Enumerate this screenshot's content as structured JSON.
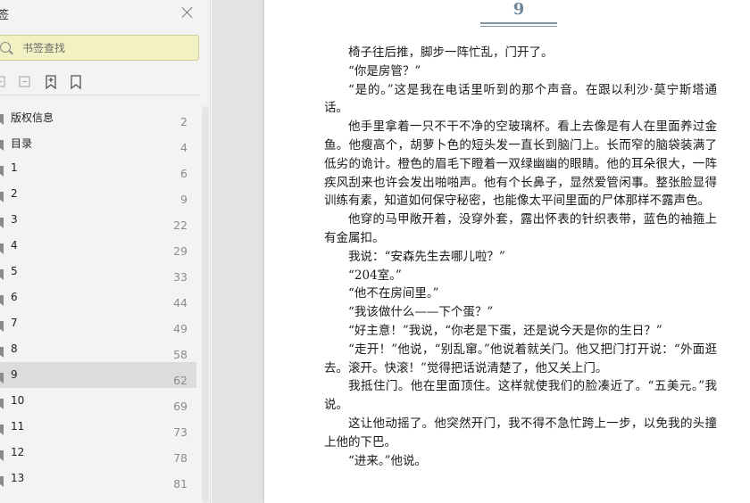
{
  "sidebar": {
    "title": "签",
    "search": {
      "placeholder": "书签查找"
    },
    "toolbar_icons": [
      "expand-all-icon",
      "collapse-all-icon",
      "add-bookmark-icon",
      "bookmark-icon"
    ],
    "items": [
      {
        "label": "版权信息",
        "page": "2"
      },
      {
        "label": "目录",
        "page": "4"
      },
      {
        "label": "1",
        "page": "6"
      },
      {
        "label": "2",
        "page": "9"
      },
      {
        "label": "3",
        "page": "22"
      },
      {
        "label": "4",
        "page": "29"
      },
      {
        "label": "5",
        "page": "33"
      },
      {
        "label": "6",
        "page": "44"
      },
      {
        "label": "7",
        "page": "49"
      },
      {
        "label": "8",
        "page": "58"
      },
      {
        "label": "9",
        "page": "62"
      },
      {
        "label": "10",
        "page": "69"
      },
      {
        "label": "11",
        "page": "73"
      },
      {
        "label": "12",
        "page": "78"
      },
      {
        "label": "13",
        "page": "81"
      }
    ],
    "selected_label": "9"
  },
  "document": {
    "chapter": "9",
    "paragraphs": [
      "椅子往后推，脚步一阵忙乱，门开了。",
      "“你是房管？”",
      "“是的。”这是我在电话里听到的那个声音。在跟以利沙·莫宁斯塔通话。",
      "他手里拿着一只不干不净的空玻璃杯。看上去像是有人在里面养过金鱼。他瘦高个，胡萝卜色的短头发一直长到脑门上。长而窄的脑袋装满了低劣的诡计。橙色的眉毛下瞪着一双绿幽幽的眼睛。他的耳朵很大，一阵疾风刮来也许会发出啪啪声。他有个长鼻子，显然爱管闲事。整张脸显得训练有素，知道如何保守秘密，也能像太平间里面的尸体那样不露声色。",
      "他穿的马甲敞开着，没穿外套，露出怀表的针织表带，蓝色的袖箍上有金属扣。",
      "我说：“安森先生去哪儿啦？”",
      "“204室。”",
      "“他不在房间里。”",
      "“我该做什么——下个蛋？”",
      "“好主意！”我说，“你老是下蛋，还是说今天是你的生日？”",
      "“走开！”他说，“别乱窜。”他说着就关门。他又把门打开说：“外面逛去。滚开。快滚！”觉得把话说清楚了，他又关上门。",
      "我抵住门。他在里面顶住。这样就使我们的脸凑近了。“五美元。”我说。",
      "这让他动摇了。他突然开门，我不得不急忙跨上一步，以免我的头撞上他的下巴。",
      "“进来。”他说。"
    ]
  }
}
